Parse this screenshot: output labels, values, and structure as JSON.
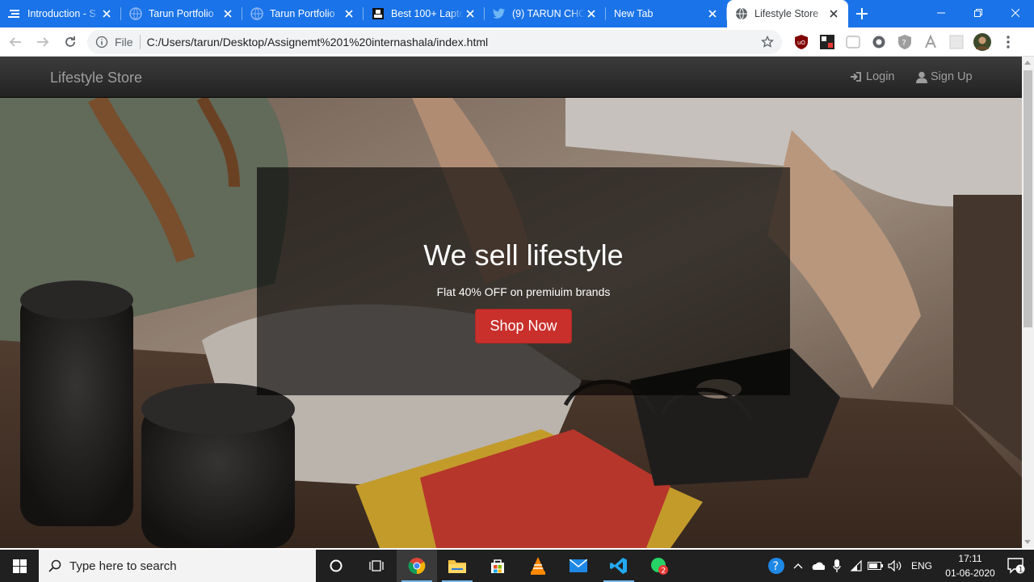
{
  "browser": {
    "tabs": [
      {
        "title": "Introduction - S",
        "icon": "stackedit-icon"
      },
      {
        "title": "Tarun Portfolio",
        "icon": "globe-icon"
      },
      {
        "title": "Tarun Portfolio",
        "icon": "globe-icon"
      },
      {
        "title": "Best 100+ Lapto",
        "icon": "amazon-icon"
      },
      {
        "title": "(9) TARUN CHO",
        "icon": "twitter-icon"
      },
      {
        "title": "New Tab",
        "icon": ""
      },
      {
        "title": "Lifestyle Store",
        "icon": "globe-icon",
        "active": true
      }
    ],
    "address": {
      "scheme": "File",
      "url": "C:/Users/tarun/Desktop/Assignemt%201%20internashala/index.html"
    },
    "accent_color": "#1a73e8"
  },
  "page": {
    "brand": "Lifestyle Store",
    "nav": {
      "login": "Login",
      "signup": "Sign Up"
    },
    "hero": {
      "heading": "We sell lifestyle",
      "subheading": "Flat 40% OFF on premiuim brands",
      "cta": "Shop Now",
      "cta_color": "#c9302c"
    }
  },
  "taskbar": {
    "search_placeholder": "Type here to search",
    "language": "ENG",
    "time": "17:11",
    "date": "01-06-2020",
    "mail_badge": "2",
    "notification_count": "1"
  }
}
